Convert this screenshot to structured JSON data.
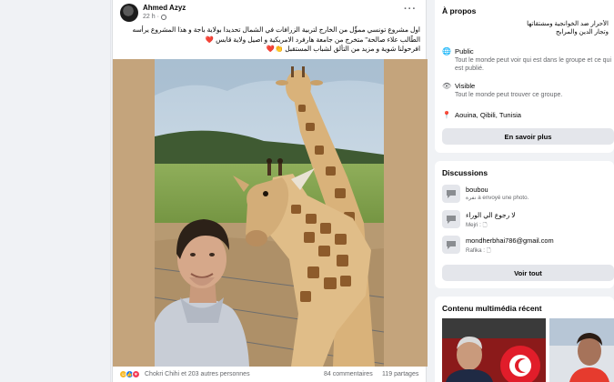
{
  "post": {
    "author": "Ahmed Azyz",
    "time": "22 h ·",
    "more": "···",
    "text_lines": [
      "اول مشروع تونسي ممؤّل من الخارج لتربية الزرافات في الشمال تحديدا بولاية باجة و هذا المشروع يرأسه",
      "الطّالب علاء صالحة\" متخرج من جامعة هارفرد الامريكية و اصيل ولاية قابس ❤️",
      "افرحولنا شوية و مزيد من التألق لشباب المستقبل 👏❤️"
    ],
    "reactors": "Chokri Chihi et 203 autres personnes",
    "comments": "84 commentaires",
    "shares": "119 partages"
  },
  "about": {
    "title": "À propos",
    "description_lines": [
      "الأحرار ضد الخوانجية ومشتقاتها",
      "وتجار الدين والمرابح"
    ],
    "public_title": "Public",
    "public_desc": "Tout le monde peut voir qui est dans le groupe et ce qui est publié.",
    "visible_title": "Visible",
    "visible_desc": "Tout le monde peut trouver ce groupe.",
    "location": "Aouina, Qibili, Tunisia",
    "learn_more": "En savoir plus"
  },
  "discussions": {
    "title": "Discussions",
    "items": [
      {
        "title": "boubou",
        "subtitle": "نفرة a envoyé une photo."
      },
      {
        "title": "لا رجوع الي الوراء",
        "subtitle": "Mejri : 🗋"
      },
      {
        "title": "mondherbhai786@gmail.com",
        "subtitle": "Rafika : 🗋"
      }
    ],
    "see_all": "Voir tout"
  },
  "media": {
    "title": "Contenu multimédia récent"
  }
}
